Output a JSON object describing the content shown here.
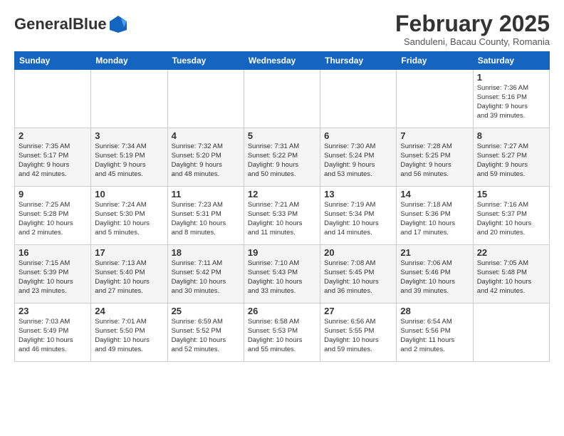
{
  "header": {
    "logo_general": "General",
    "logo_blue": "Blue",
    "title": "February 2025",
    "subtitle": "Sanduleni, Bacau County, Romania"
  },
  "columns": [
    "Sunday",
    "Monday",
    "Tuesday",
    "Wednesday",
    "Thursday",
    "Friday",
    "Saturday"
  ],
  "weeks": [
    [
      {
        "day": "",
        "info": ""
      },
      {
        "day": "",
        "info": ""
      },
      {
        "day": "",
        "info": ""
      },
      {
        "day": "",
        "info": ""
      },
      {
        "day": "",
        "info": ""
      },
      {
        "day": "",
        "info": ""
      },
      {
        "day": "1",
        "info": "Sunrise: 7:36 AM\nSunset: 5:16 PM\nDaylight: 9 hours\nand 39 minutes."
      }
    ],
    [
      {
        "day": "2",
        "info": "Sunrise: 7:35 AM\nSunset: 5:17 PM\nDaylight: 9 hours\nand 42 minutes."
      },
      {
        "day": "3",
        "info": "Sunrise: 7:34 AM\nSunset: 5:19 PM\nDaylight: 9 hours\nand 45 minutes."
      },
      {
        "day": "4",
        "info": "Sunrise: 7:32 AM\nSunset: 5:20 PM\nDaylight: 9 hours\nand 48 minutes."
      },
      {
        "day": "5",
        "info": "Sunrise: 7:31 AM\nSunset: 5:22 PM\nDaylight: 9 hours\nand 50 minutes."
      },
      {
        "day": "6",
        "info": "Sunrise: 7:30 AM\nSunset: 5:24 PM\nDaylight: 9 hours\nand 53 minutes."
      },
      {
        "day": "7",
        "info": "Sunrise: 7:28 AM\nSunset: 5:25 PM\nDaylight: 9 hours\nand 56 minutes."
      },
      {
        "day": "8",
        "info": "Sunrise: 7:27 AM\nSunset: 5:27 PM\nDaylight: 9 hours\nand 59 minutes."
      }
    ],
    [
      {
        "day": "9",
        "info": "Sunrise: 7:25 AM\nSunset: 5:28 PM\nDaylight: 10 hours\nand 2 minutes."
      },
      {
        "day": "10",
        "info": "Sunrise: 7:24 AM\nSunset: 5:30 PM\nDaylight: 10 hours\nand 5 minutes."
      },
      {
        "day": "11",
        "info": "Sunrise: 7:23 AM\nSunset: 5:31 PM\nDaylight: 10 hours\nand 8 minutes."
      },
      {
        "day": "12",
        "info": "Sunrise: 7:21 AM\nSunset: 5:33 PM\nDaylight: 10 hours\nand 11 minutes."
      },
      {
        "day": "13",
        "info": "Sunrise: 7:19 AM\nSunset: 5:34 PM\nDaylight: 10 hours\nand 14 minutes."
      },
      {
        "day": "14",
        "info": "Sunrise: 7:18 AM\nSunset: 5:36 PM\nDaylight: 10 hours\nand 17 minutes."
      },
      {
        "day": "15",
        "info": "Sunrise: 7:16 AM\nSunset: 5:37 PM\nDaylight: 10 hours\nand 20 minutes."
      }
    ],
    [
      {
        "day": "16",
        "info": "Sunrise: 7:15 AM\nSunset: 5:39 PM\nDaylight: 10 hours\nand 23 minutes."
      },
      {
        "day": "17",
        "info": "Sunrise: 7:13 AM\nSunset: 5:40 PM\nDaylight: 10 hours\nand 27 minutes."
      },
      {
        "day": "18",
        "info": "Sunrise: 7:11 AM\nSunset: 5:42 PM\nDaylight: 10 hours\nand 30 minutes."
      },
      {
        "day": "19",
        "info": "Sunrise: 7:10 AM\nSunset: 5:43 PM\nDaylight: 10 hours\nand 33 minutes."
      },
      {
        "day": "20",
        "info": "Sunrise: 7:08 AM\nSunset: 5:45 PM\nDaylight: 10 hours\nand 36 minutes."
      },
      {
        "day": "21",
        "info": "Sunrise: 7:06 AM\nSunset: 5:46 PM\nDaylight: 10 hours\nand 39 minutes."
      },
      {
        "day": "22",
        "info": "Sunrise: 7:05 AM\nSunset: 5:48 PM\nDaylight: 10 hours\nand 42 minutes."
      }
    ],
    [
      {
        "day": "23",
        "info": "Sunrise: 7:03 AM\nSunset: 5:49 PM\nDaylight: 10 hours\nand 46 minutes."
      },
      {
        "day": "24",
        "info": "Sunrise: 7:01 AM\nSunset: 5:50 PM\nDaylight: 10 hours\nand 49 minutes."
      },
      {
        "day": "25",
        "info": "Sunrise: 6:59 AM\nSunset: 5:52 PM\nDaylight: 10 hours\nand 52 minutes."
      },
      {
        "day": "26",
        "info": "Sunrise: 6:58 AM\nSunset: 5:53 PM\nDaylight: 10 hours\nand 55 minutes."
      },
      {
        "day": "27",
        "info": "Sunrise: 6:56 AM\nSunset: 5:55 PM\nDaylight: 10 hours\nand 59 minutes."
      },
      {
        "day": "28",
        "info": "Sunrise: 6:54 AM\nSunset: 5:56 PM\nDaylight: 11 hours\nand 2 minutes."
      },
      {
        "day": "",
        "info": ""
      }
    ]
  ]
}
